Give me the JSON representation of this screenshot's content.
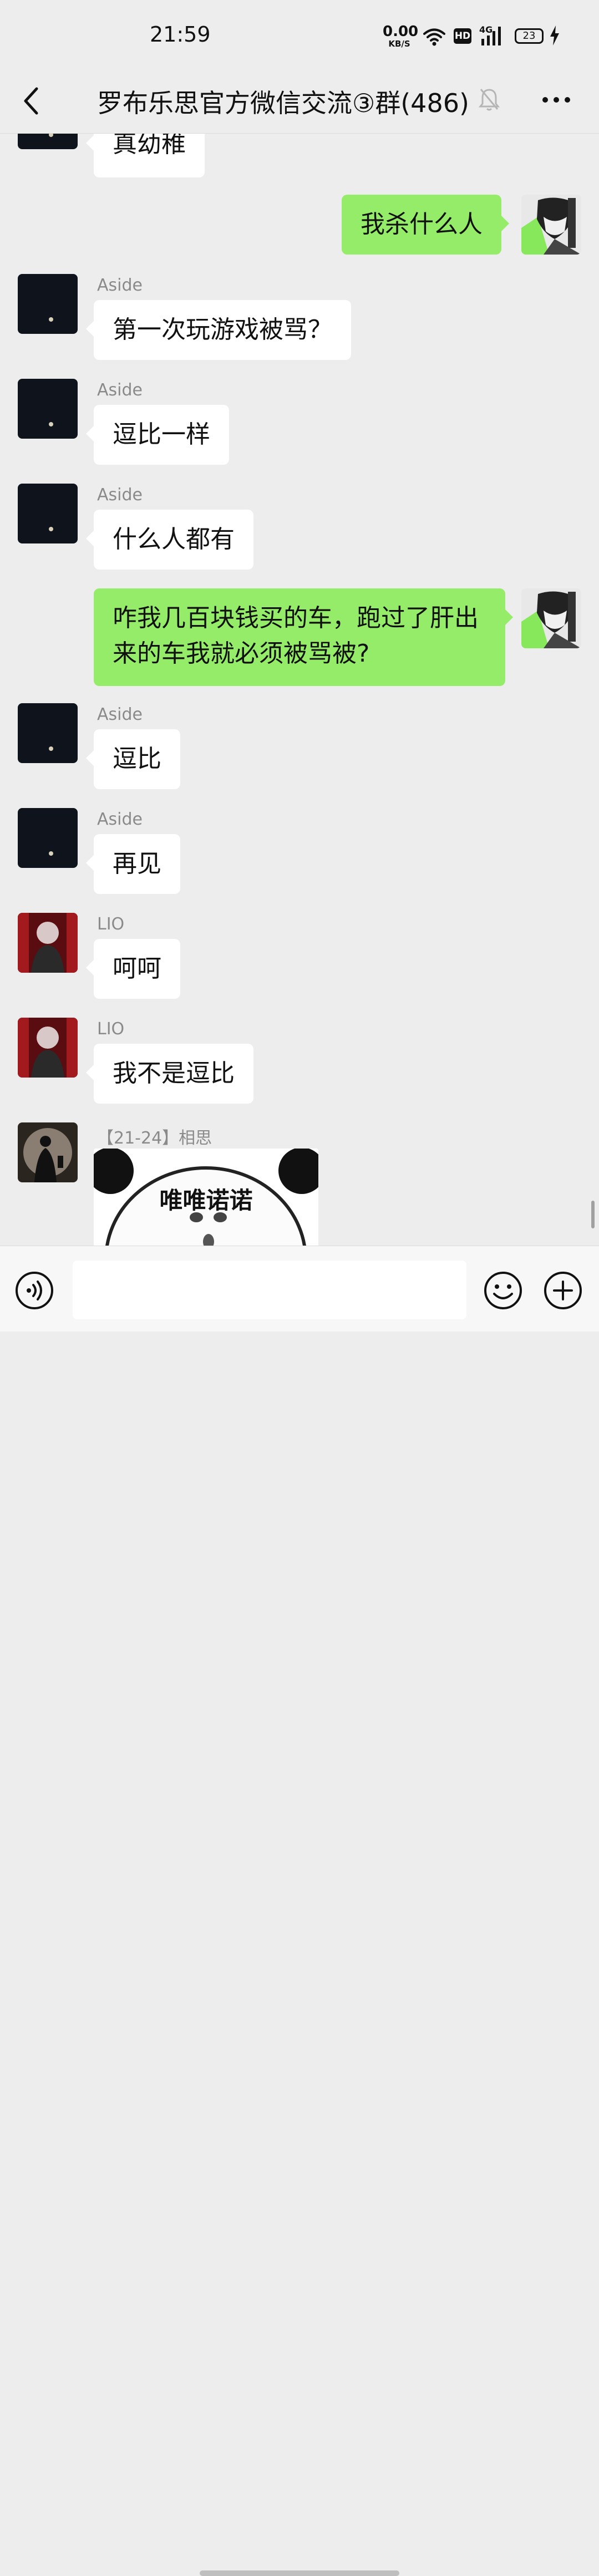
{
  "status_bar": {
    "time": "21:59",
    "net_speed_value": "0.00",
    "net_speed_unit": "KB/S",
    "hd_badge": "HD",
    "network_type": "4G",
    "battery_level": "23",
    "icons": [
      "wifi-icon",
      "hd-icon",
      "signal-4g-icon",
      "battery-icon",
      "charging-bolt-icon"
    ]
  },
  "nav": {
    "back_icon": "chevron-left-icon",
    "title": "罗布乐思官方微信交流③群(486)",
    "muted_icon": "bell-off-icon",
    "more_icon": "more-dots-icon"
  },
  "messages": [
    {
      "side": "left",
      "sender": "",
      "avatar": "avatar-aside",
      "text": "真幼稚"
    },
    {
      "side": "right",
      "sender": "",
      "avatar": "avatar-me",
      "text": "我杀什么人"
    },
    {
      "side": "left",
      "sender": "Aside",
      "avatar": "avatar-aside",
      "text": "第一次玩游戏被骂？"
    },
    {
      "side": "left",
      "sender": "Aside",
      "avatar": "avatar-aside",
      "text": "逗比一样"
    },
    {
      "side": "left",
      "sender": "Aside",
      "avatar": "avatar-aside",
      "text": "什么人都有"
    },
    {
      "side": "right",
      "sender": "",
      "avatar": "avatar-me",
      "text": "咋我几百块钱买的车，跑过了肝出来的车我就必须被骂被?"
    },
    {
      "side": "left",
      "sender": "Aside",
      "avatar": "avatar-aside",
      "text": "逗比"
    },
    {
      "side": "left",
      "sender": "Aside",
      "avatar": "avatar-aside",
      "text": "再见"
    },
    {
      "side": "left",
      "sender": "LIO",
      "avatar": "avatar-lio",
      "text": "呵呵"
    },
    {
      "side": "left",
      "sender": "LIO",
      "avatar": "avatar-lio",
      "text": "我不是逗比"
    },
    {
      "side": "left",
      "sender": "【21-24】相思",
      "avatar": "avatar-xiangsi",
      "sticker_text": "唯唯诺诺"
    }
  ],
  "input_bar": {
    "voice_icon": "voice-icon",
    "input_value": "",
    "emoji_icon": "emoji-icon",
    "plus_icon": "plus-icon"
  },
  "colors": {
    "background": "#ededed",
    "bubble_self": "#95ec69",
    "bubble_other": "#ffffff",
    "sender_name": "#8a8a8a"
  }
}
